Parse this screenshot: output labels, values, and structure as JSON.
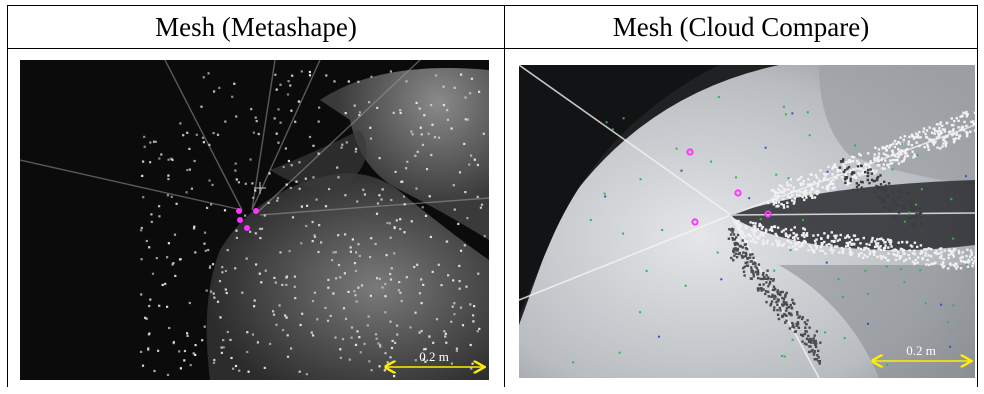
{
  "headers": {
    "left": "Mesh (Metashape)",
    "right": "Mesh (Cloud Compare)"
  },
  "panels": {
    "left": {
      "scale_label": "0.2 m"
    },
    "right": {
      "scale_label": "0.2 m"
    }
  },
  "colors": {
    "marker": "#ff33ff",
    "scale_arrow": "#ffee00",
    "left_bg": "#0b0b0b",
    "right_bg": "#e2e4e6"
  }
}
